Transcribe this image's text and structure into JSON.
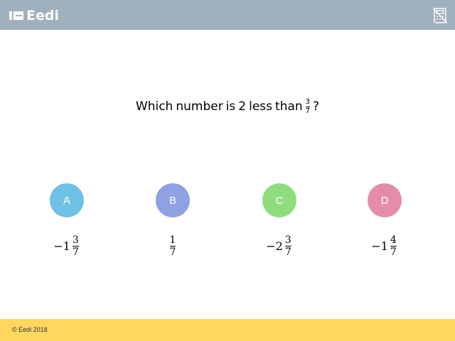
{
  "header": {
    "brand": "Eedi",
    "colors": {
      "bar": "#a0afbd",
      "logo": "#ffffff"
    },
    "icons": {
      "logo": "eedi-logo-icon",
      "calculator": "calculator-disabled-icon"
    }
  },
  "question": {
    "words": [
      "Which",
      "number",
      "is",
      "2",
      "less",
      "than"
    ],
    "fraction": {
      "numerator": "3",
      "denominator": "7"
    },
    "end": "?"
  },
  "options": [
    {
      "letter": "A",
      "color": "#6ec1e4",
      "whole": "−1",
      "numerator": "3",
      "denominator": "7"
    },
    {
      "letter": "B",
      "color": "#8fa0e3",
      "whole": "",
      "numerator": "1",
      "denominator": "7"
    },
    {
      "letter": "C",
      "color": "#8fdc7e",
      "whole": "−2",
      "numerator": "3",
      "denominator": "7"
    },
    {
      "letter": "D",
      "color": "#e58da8",
      "whole": "−1",
      "numerator": "4",
      "denominator": "7"
    }
  ],
  "footer": {
    "copyright": "© Eedi 2018",
    "color": "#ffd75e"
  }
}
